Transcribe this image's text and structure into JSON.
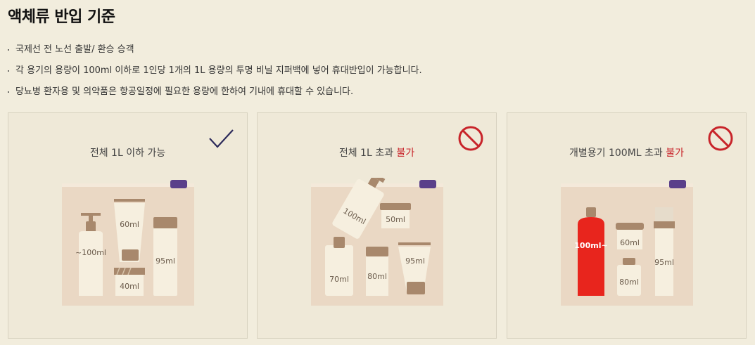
{
  "page": {
    "title": "액체류 반입 기준"
  },
  "rules": [
    "국제선 전 노선 출발/ 환승 승객",
    "각 용기의 용량이 100ml 이하로 1인당 1개의 1L 용량의 투명 비닐 지퍼백에 넣어 휴대반입이 가능합니다.",
    "당뇨병 환자용 및 의약품은 항공일정에 필요한 용량에 한하여 기내에 휴대할 수 있습니다."
  ],
  "cards": [
    {
      "title_prefix": "전체 1L 이하 가능",
      "title_warn": "",
      "status_icon": "check-icon",
      "labels": {
        "bottle": "~100ml",
        "tube": "60ml",
        "small": "40ml",
        "jar": "95ml"
      }
    },
    {
      "title_prefix": "전체 1L 초과 ",
      "title_warn": "불가",
      "status_icon": "prohibited-icon",
      "labels": {
        "spray": "100ml",
        "jar": "50ml",
        "bottle": "70ml",
        "tub": "80ml",
        "tube": "95ml"
      }
    },
    {
      "title_prefix": "개별용기 100ML 초과 ",
      "title_warn": "불가",
      "status_icon": "prohibited-icon",
      "labels": {
        "red": "100ml~",
        "tub": "60ml",
        "small": "80ml",
        "tall": "95ml"
      }
    }
  ],
  "colors": {
    "background": "#f2eddd",
    "card_border": "#d8d2c0",
    "warn": "#c8242a",
    "check": "#2c2a5a",
    "bag": "#ead8c4",
    "zip_tab": "#5a3f8a",
    "container": "#f6efdf",
    "cap": "#a8886c",
    "red_bottle": "#e8251d"
  }
}
